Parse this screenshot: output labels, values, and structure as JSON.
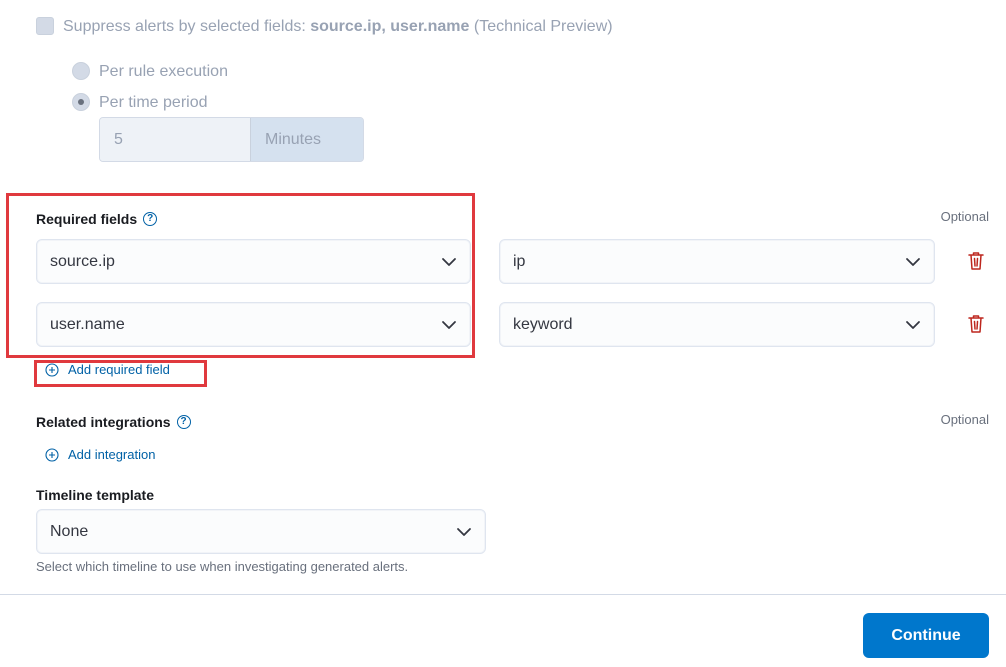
{
  "suppress": {
    "prefix": "Suppress alerts by selected fields: ",
    "fields": "source.ip, user.name",
    "suffix": " (Technical Preview)",
    "options": [
      {
        "label": "Per rule execution",
        "checked": false
      },
      {
        "label": "Per time period",
        "checked": true
      }
    ],
    "duration_value": "5",
    "duration_unit": "Minutes"
  },
  "required_fields": {
    "label": "Required fields",
    "optional": "Optional",
    "rows": [
      {
        "name": "source.ip",
        "type": "ip"
      },
      {
        "name": "user.name",
        "type": "keyword"
      }
    ],
    "add_label": "Add required field"
  },
  "related_integrations": {
    "label": "Related integrations",
    "optional": "Optional",
    "add_label": "Add integration"
  },
  "timeline_template": {
    "label": "Timeline template",
    "value": "None",
    "help": "Select which timeline to use when investigating generated alerts."
  },
  "footer": {
    "continue_label": "Continue"
  },
  "colors": {
    "accent": "#0077cc",
    "link": "#0061a6",
    "danger": "#bd271e",
    "highlight": "#e0393e"
  },
  "icons": {
    "help": "question-circle-icon",
    "chevron": "chevron-down-icon",
    "trash": "trash-icon",
    "add": "plus-circle-icon"
  }
}
